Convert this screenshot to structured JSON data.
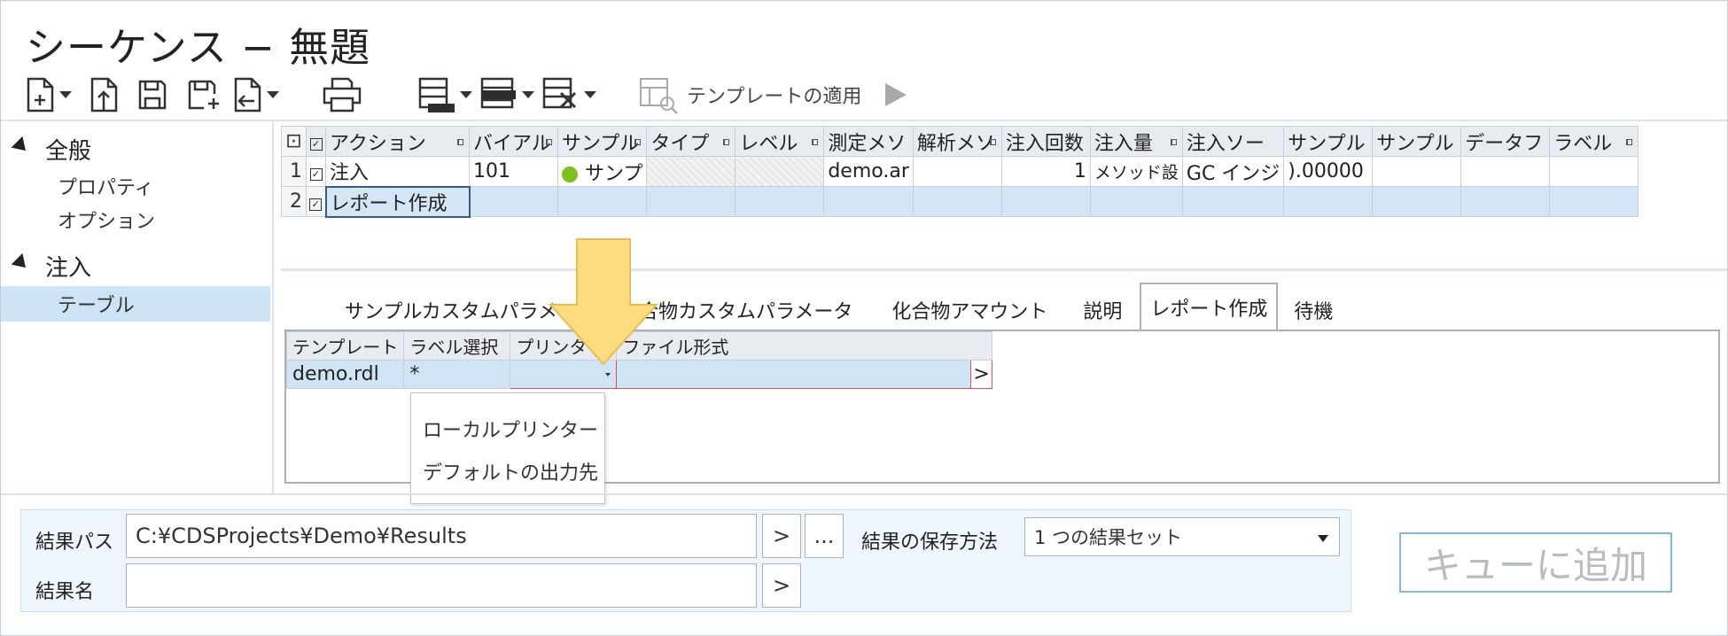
{
  "window": {
    "title": "シーケンス − 無題"
  },
  "toolbar": {
    "icons": [
      "new-doc-icon",
      "import-icon",
      "save-icon",
      "save-as-icon",
      "export-icon",
      "print-icon",
      "insert-rows-icon",
      "insert-row-icon",
      "delete-row-icon",
      "template-icon",
      "play-icon"
    ],
    "template_label": "テンプレートの適用"
  },
  "nav": {
    "groups": [
      {
        "label": "全般",
        "items": [
          "プロパティ",
          "オプション"
        ]
      },
      {
        "label": "注入",
        "items": [
          "テーブル"
        ]
      }
    ],
    "selected": "テーブル"
  },
  "main_table": {
    "columns": [
      "アクション",
      "バイアル",
      "サンプル",
      "タイプ",
      "レベル",
      "測定メソ",
      "解析メソ",
      "注入回数",
      "注入量",
      "注入ソー",
      "サンプル",
      "サンプル",
      "データフ",
      "ラベル"
    ],
    "rows": [
      {
        "num": "1",
        "cells": [
          "注入",
          "101",
          "サンプ",
          "",
          "",
          "demo.ar",
          "",
          "1",
          "メソッド設",
          "GC インジ",
          ").00000",
          "",
          "",
          ""
        ]
      },
      {
        "num": "2",
        "cells": [
          "レポート作成",
          "",
          "",
          "",
          "",
          "",
          "",
          "",
          "",
          "",
          "",
          "",
          "",
          ""
        ]
      }
    ]
  },
  "detail_tabs": {
    "tabs": [
      "サンプルカスタムパラメータ",
      "化合物カスタムパラメータ",
      "化合物アマウント",
      "説明",
      "レポート作成",
      "待機"
    ],
    "active": "レポート作成"
  },
  "report_table": {
    "columns": [
      "テンプレート",
      "ラベル選択",
      "プリンター",
      "ファイル形式"
    ],
    "row": [
      "demo.rdl",
      "*",
      "",
      ""
    ],
    "arrow_btn": ">"
  },
  "printer_dropdown": {
    "options": [
      "ローカルプリンター",
      "デフォルトの出力先"
    ]
  },
  "bottom": {
    "result_path_label": "結果パス",
    "result_path_value": "C:¥CDSProjects¥Demo¥Results",
    "path_btn": ">",
    "browse_btn": "...",
    "save_method_label": "結果の保存方法",
    "save_method_value": "1 つの結果セット",
    "result_name_label": "結果名",
    "result_name_value": "",
    "name_btn": ">",
    "queue_btn": "キューに追加"
  },
  "colors": {
    "selection": "#cfe4f5",
    "highlight_arrow": "#fddc80",
    "status_green": "#7dc11f",
    "error_border": "#e05050"
  }
}
